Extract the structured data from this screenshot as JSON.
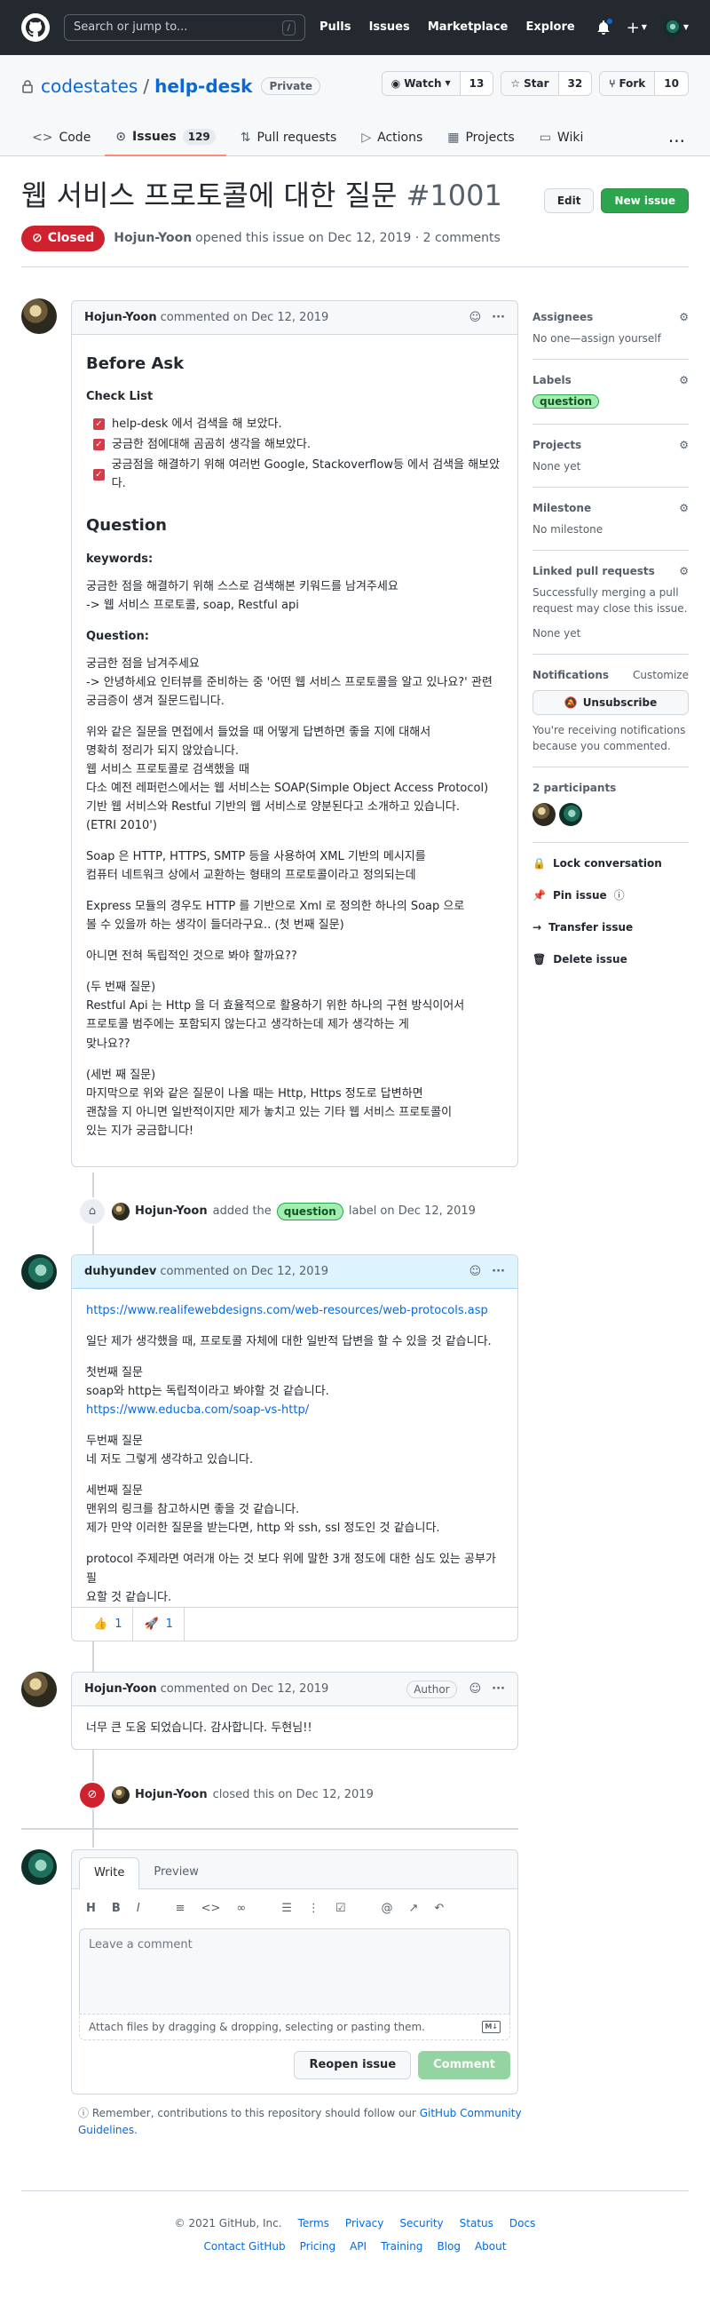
{
  "header": {
    "search_placeholder": "Search or jump to...",
    "slash": "/",
    "nav": [
      "Pulls",
      "Issues",
      "Marketplace",
      "Explore"
    ]
  },
  "repo": {
    "owner": "codestates",
    "sep": "/",
    "name": "help-desk",
    "visibility": "Private",
    "watch": {
      "label": "Watch",
      "count": "13"
    },
    "star": {
      "label": "Star",
      "count": "32"
    },
    "fork": {
      "label": "Fork",
      "count": "10"
    },
    "tabs": [
      {
        "label": "Code"
      },
      {
        "label": "Issues",
        "count": "129"
      },
      {
        "label": "Pull requests"
      },
      {
        "label": "Actions"
      },
      {
        "label": "Projects"
      },
      {
        "label": "Wiki"
      }
    ],
    "more": "···"
  },
  "issue": {
    "title": "웹 서비스 프로토콜에 대한 질문",
    "number": "#1001",
    "edit_label": "Edit",
    "new_label": "New issue",
    "state": "Closed",
    "author": "Hojun-Yoon",
    "meta": "opened this issue on Dec 12, 2019 · 2 comments"
  },
  "comment1": {
    "author": "Hojun-Yoon",
    "meta": "commented on Dec 12, 2019",
    "before_ask": "Before Ask",
    "check_list": "Check List",
    "tasks": [
      "help-desk 에서 검색을 해 보았다.",
      "궁금한 점에대해 곰곰히 생각을 해보았다.",
      "궁금점을 해결하기 위해 여러번 Google, Stackoverflow등 에서 검색을 해보았다."
    ],
    "question_h": "Question",
    "keywords_h": "keywords:",
    "keywords_1": "궁금한 점을 해결하기 위해 스스로 검색해본 키워드를 남겨주세요",
    "keywords_2": "-> 웹 서비스 프로토콜, soap, Restful api",
    "question_sub": "Question:",
    "q1": "궁금한 점을 남겨주세요",
    "q2": "-> 안녕하세요 인터뷰를 준비하는 중 '어떤 웹 서비스 프로토콜을 알고 있나요?' 관련",
    "q3": "궁금증이 생겨 질문드립니다.",
    "p1": [
      "위와 같은 질문을 면접에서 들었을 때 어떻게 답변하면 좋을 지에 대해서",
      "명확히 정리가 되지 않았습니다.",
      "웹 서비스 프로토콜로 검색했을 때",
      "다소 예전 레퍼런스에서는 웹 서비스는 SOAP(Simple Object Access Protocol)",
      "기반 웹 서비스와 Restful 기반의 웹 서비스로 양분된다고 소개하고 있습니다.",
      "(ETRI 2010')"
    ],
    "p2": [
      "Soap 은 HTTP, HTTPS, SMTP 등을 사용하여 XML 기반의 메시지를",
      "컴퓨터 네트워크 상에서 교환하는 형태의 프로토콜이라고 정의되는데"
    ],
    "p3": [
      "Express 모듈의 경우도 HTTP 를 기반으로 Xml 로 정의한 하나의 Soap 으로",
      "볼 수 있을까 하는 생각이 들더라구요.. (첫 번째 질문)"
    ],
    "p4": [
      "아니면 전혀 독립적인 것으로 봐야 할까요??"
    ],
    "p5": [
      "(두 번째 질문)",
      "Restful Api 는 Http 을 더 효율적으로 활용하기 위한 하나의 구현 방식이어서",
      "프로토콜 범주에는 포함되지 않는다고 생각하는데 제가 생각하는 게",
      "맞나요??"
    ],
    "p6": [
      "(세번 째 질문)",
      "마지막으로 위와 같은 질문이 나올 때는 Http, Https 정도로 답변하면",
      "괜찮을 지 아니면 일반적이지만 제가 놓치고 있는 기타 웹 서비스 프로토콜이",
      "있는 지가 궁금합니다!"
    ]
  },
  "event_label": {
    "actor": "Hojun-Yoon",
    "text1": "added the",
    "label": "question",
    "text2": "label on Dec 12, 2019"
  },
  "comment2": {
    "author": "duhyundev",
    "meta": "commented on Dec 12, 2019",
    "link1": "https://www.realifewebdesigns.com/web-resources/web-protocols.asp",
    "l1": "일단 제가 생각했을 때, 프로토콜 자체에 대한 일반적 답변을 할 수 있을 것 같습니다.",
    "a1": [
      "첫번째 질문",
      "soap와 http는 독립적이라고 봐야할 것 같습니다."
    ],
    "link2": "https://www.educba.com/soap-vs-http/",
    "a2": [
      "두번째 질문",
      "네 저도 그렇게 생각하고 있습니다."
    ],
    "a3": [
      "세번째 질문",
      "맨위의 링크를 참고하시면 좋을 것 같습니다.",
      "제가 만약 이러한 질문을 받는다면, http 와 ssh, ssl 정도인 것 같습니다."
    ],
    "a4": [
      "protocol 주제라면 여러개 아는 것 보다 위에 말한 3개 정도에 대한 심도 있는 공부가 필",
      "요할 것 같습니다."
    ],
    "reactions": [
      {
        "emoji": "👍",
        "count": "1"
      },
      {
        "emoji": "🚀",
        "count": "1"
      }
    ]
  },
  "comment3": {
    "author": "Hojun-Yoon",
    "meta": "commented on Dec 12, 2019",
    "badge": "Author",
    "body": "너무 큰 도움 되었습니다. 감사합니다. 두현님!!"
  },
  "event_closed": {
    "actor": "Hojun-Yoon",
    "text": "closed this on Dec 12, 2019"
  },
  "editor": {
    "tab_write": "Write",
    "tab_preview": "Preview",
    "placeholder": "Leave a comment",
    "attach": "Attach files by dragging & dropping, selecting or pasting them.",
    "reopen": "Reopen issue",
    "comment": "Comment",
    "note_prefix": "Remember, contributions to this repository should follow our",
    "note_link": "GitHub Community Guidelines",
    "note_suffix": "."
  },
  "sidebar": {
    "assignees_h": "Assignees",
    "assignees_v": "No one—assign yourself",
    "labels_h": "Labels",
    "labels_v": "question",
    "projects_h": "Projects",
    "projects_v": "None yet",
    "milestone_h": "Milestone",
    "milestone_v": "No milestone",
    "linked_h": "Linked pull requests",
    "linked_note": "Successfully merging a pull request may close this issue.",
    "linked_v": "None yet",
    "notif_h": "Notifications",
    "notif_customize": "Customize",
    "unsubscribe": "Unsubscribe",
    "notif_note": "You're receiving notifications because you commented.",
    "participants_h": "2 participants",
    "lock": "Lock conversation",
    "pin": "Pin issue",
    "transfer": "Transfer issue",
    "delete": "Delete issue"
  },
  "footer": {
    "copyright": "© 2021 GitHub, Inc.",
    "row1": [
      "Terms",
      "Privacy",
      "Security",
      "Status",
      "Docs"
    ],
    "row2": [
      "Contact GitHub",
      "Pricing",
      "API",
      "Training",
      "Blog",
      "About"
    ]
  }
}
